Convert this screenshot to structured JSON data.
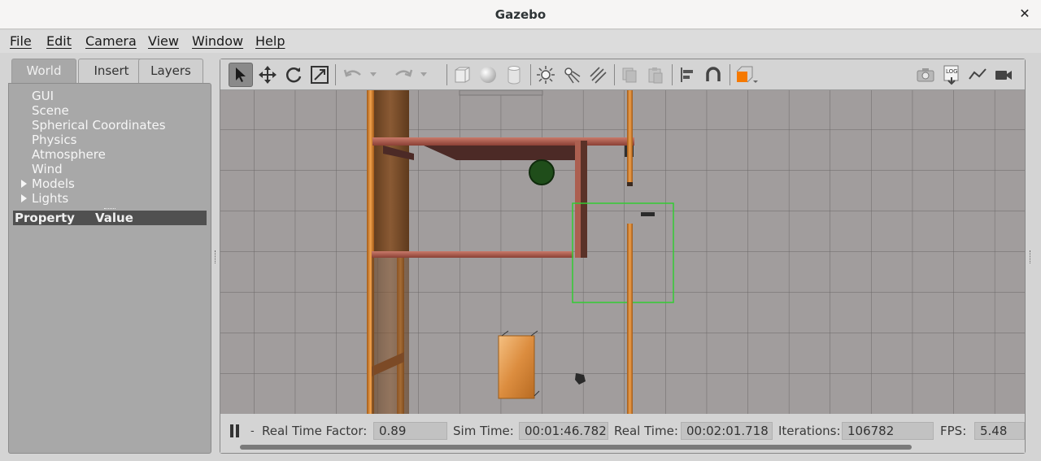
{
  "window": {
    "title": "Gazebo",
    "close_glyph": "✕"
  },
  "menu": [
    "File",
    "Edit",
    "Camera",
    "View",
    "Window",
    "Help"
  ],
  "left_panel": {
    "tabs": [
      "World",
      "Insert",
      "Layers"
    ],
    "active_tab": "World",
    "tree": [
      {
        "label": "GUI",
        "expandable": false
      },
      {
        "label": "Scene",
        "expandable": false
      },
      {
        "label": "Spherical Coordinates",
        "expandable": false
      },
      {
        "label": "Physics",
        "expandable": false
      },
      {
        "label": "Atmosphere",
        "expandable": false
      },
      {
        "label": "Wind",
        "expandable": false
      },
      {
        "label": "Models",
        "expandable": true
      },
      {
        "label": "Lights",
        "expandable": true
      }
    ],
    "property_header": {
      "property": "Property",
      "value": "Value"
    }
  },
  "toolbar": {
    "icons": [
      "select-arrow-icon",
      "translate-icon",
      "rotate-icon",
      "scale-icon",
      "undo-icon",
      "undo-dropdown-icon",
      "redo-icon",
      "redo-dropdown-icon",
      "box-icon",
      "sphere-icon",
      "cylinder-icon",
      "point-light-icon",
      "spot-light-icon",
      "directional-light-icon",
      "copy-icon",
      "paste-icon",
      "align-icon",
      "snap-icon",
      "view-angle-icon",
      "screenshot-icon",
      "log-icon",
      "plot-icon",
      "record-video-icon"
    ],
    "active_tool": "select-arrow-icon",
    "accent_color": "#f57900"
  },
  "status": {
    "realtime_factor_label": "Real Time Factor:",
    "realtime_factor": "0.89",
    "sim_time_label": "Sim Time:",
    "sim_time": "00:01:46.782",
    "real_time_label": "Real Time:",
    "real_time": "00:02:01.718",
    "iterations_label": "Iterations:",
    "iterations": "106782",
    "fps_label": "FPS:",
    "fps": "5.48",
    "step_label": "-"
  },
  "scene": {
    "grid_color": "#6a6a6a",
    "ground_color": "#a19d9d",
    "selection_color": "#33cc33"
  }
}
